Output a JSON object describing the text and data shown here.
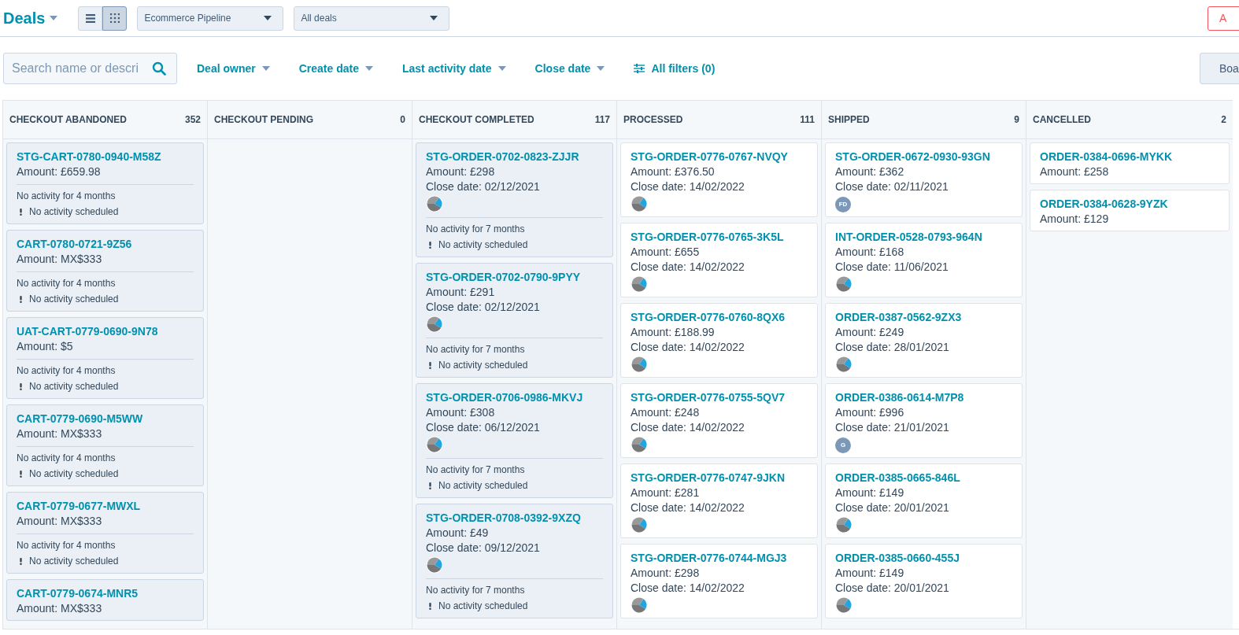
{
  "header": {
    "title": "Deals",
    "views": [
      {
        "kind": "list",
        "selected": false
      },
      {
        "kind": "board",
        "selected": true
      }
    ],
    "pipeline": "Ecommerce Pipeline",
    "view_filter": "All deals",
    "action_button": "A"
  },
  "filter_bar": {
    "search": {
      "placeholder": "Search name or descri"
    },
    "filters": [
      {
        "label": "Deal owner",
        "kind": "dropdown"
      },
      {
        "label": "Create date",
        "kind": "dropdown"
      },
      {
        "label": "Last activity date",
        "kind": "dropdown"
      },
      {
        "label": "Close date",
        "kind": "dropdown"
      },
      {
        "label": "All filters (0)",
        "kind": "all"
      }
    ],
    "board_button": "Boa"
  },
  "columns": [
    {
      "name": "CHECKOUT ABANDONED",
      "count": "352",
      "cards": [
        {
          "title": "STG-CART-0780-0940-M58Z",
          "amount": "Amount: £659.98",
          "stale": true,
          "activity": [
            "No activity for 4 months",
            "No activity scheduled"
          ]
        },
        {
          "title": "CART-0780-0721-9Z56",
          "amount": "Amount: MX$333",
          "stale": true,
          "activity": [
            "No activity for 4 months",
            "No activity scheduled"
          ]
        },
        {
          "title": "UAT-CART-0779-0690-9N78",
          "amount": "Amount: $5",
          "stale": true,
          "activity": [
            "No activity for 4 months",
            "No activity scheduled"
          ]
        },
        {
          "title": "CART-0779-0690-M5WW",
          "amount": "Amount: MX$333",
          "stale": true,
          "activity": [
            "No activity for 4 months",
            "No activity scheduled"
          ]
        },
        {
          "title": "CART-0779-0677-MWXL",
          "amount": "Amount: MX$333",
          "stale": true,
          "activity": [
            "No activity for 4 months",
            "No activity scheduled"
          ]
        },
        {
          "title": "CART-0779-0674-MNR5",
          "amount": "Amount: MX$333",
          "stale": true
        }
      ]
    },
    {
      "name": "CHECKOUT PENDING",
      "count": "0"
    },
    {
      "name": "CHECKOUT COMPLETED",
      "count": "117",
      "cards": [
        {
          "title": "STG-ORDER-0702-0823-ZJJR",
          "amount": "Amount: £298",
          "close_date": "Close date: 02/12/2021",
          "avatar": {
            "kind": "pie"
          },
          "stale": true,
          "activity": [
            "No activity for 7 months",
            "No activity scheduled"
          ]
        },
        {
          "title": "STG-ORDER-0702-0790-9PYY",
          "amount": "Amount: £291",
          "close_date": "Close date: 02/12/2021",
          "avatar": {
            "kind": "pie"
          },
          "stale": true,
          "activity": [
            "No activity for 7 months",
            "No activity scheduled"
          ]
        },
        {
          "title": "STG-ORDER-0706-0986-MKVJ",
          "amount": "Amount: £308",
          "close_date": "Close date: 06/12/2021",
          "avatar": {
            "kind": "pie"
          },
          "stale": true,
          "activity": [
            "No activity for 7 months",
            "No activity scheduled"
          ]
        },
        {
          "title": "STG-ORDER-0708-0392-9XZQ",
          "amount": "Amount: £49",
          "close_date": "Close date: 09/12/2021",
          "avatar": {
            "kind": "pie"
          },
          "stale": true,
          "activity": [
            "No activity for 7 months",
            "No activity scheduled"
          ]
        }
      ]
    },
    {
      "name": "PROCESSED",
      "count": "111",
      "cards": [
        {
          "title": "STG-ORDER-0776-0767-NVQY",
          "amount": "Amount: £376.50",
          "close_date": "Close date: 14/02/2022",
          "avatar": {
            "kind": "pie"
          },
          "stale": false
        },
        {
          "title": "STG-ORDER-0776-0765-3K5L",
          "amount": "Amount: £655",
          "close_date": "Close date: 14/02/2022",
          "avatar": {
            "kind": "pie"
          },
          "stale": false
        },
        {
          "title": "STG-ORDER-0776-0760-8QX6",
          "amount": "Amount: £188.99",
          "close_date": "Close date: 14/02/2022",
          "avatar": {
            "kind": "pie"
          },
          "stale": false
        },
        {
          "title": "STG-ORDER-0776-0755-5QV7",
          "amount": "Amount: £248",
          "close_date": "Close date: 14/02/2022",
          "avatar": {
            "kind": "pie"
          },
          "stale": false
        },
        {
          "title": "STG-ORDER-0776-0747-9JKN",
          "amount": "Amount: £281",
          "close_date": "Close date: 14/02/2022",
          "avatar": {
            "kind": "pie"
          },
          "stale": false
        },
        {
          "title": "STG-ORDER-0776-0744-MGJ3",
          "amount": "Amount: £298",
          "close_date": "Close date: 14/02/2022",
          "avatar": {
            "kind": "pie"
          },
          "stale": false
        }
      ]
    },
    {
      "name": "SHIPPED",
      "count": "9",
      "cards": [
        {
          "title": "STG-ORDER-0672-0930-93GN",
          "amount": "Amount: £362",
          "close_date": "Close date: 02/11/2021",
          "avatar": {
            "kind": "initials",
            "text": "FD"
          },
          "stale": false
        },
        {
          "title": "INT-ORDER-0528-0793-964N",
          "amount": "Amount: £168",
          "close_date": "Close date: 11/06/2021",
          "avatar": {
            "kind": "pie"
          },
          "stale": false
        },
        {
          "title": "ORDER-0387-0562-9ZX3",
          "amount": "Amount: £249",
          "close_date": "Close date: 28/01/2021",
          "avatar": {
            "kind": "pie"
          },
          "stale": false
        },
        {
          "title": "ORDER-0386-0614-M7P8",
          "amount": "Amount: £996",
          "close_date": "Close date: 21/01/2021",
          "avatar": {
            "kind": "initials",
            "text": "G"
          },
          "stale": false
        },
        {
          "title": "ORDER-0385-0665-846L",
          "amount": "Amount: £149",
          "close_date": "Close date: 20/01/2021",
          "avatar": {
            "kind": "pie"
          },
          "stale": false
        },
        {
          "title": "ORDER-0385-0660-455J",
          "amount": "Amount: £149",
          "close_date": "Close date: 20/01/2021",
          "avatar": {
            "kind": "pie"
          },
          "stale": false
        }
      ]
    },
    {
      "name": "CANCELLED",
      "count": "2",
      "cards": [
        {
          "title": "ORDER-0384-0696-MYKK",
          "amount": "Amount: £258",
          "stale": false
        },
        {
          "title": "ORDER-0384-0628-9YZK",
          "amount": "Amount: £129",
          "stale": false
        }
      ]
    }
  ]
}
